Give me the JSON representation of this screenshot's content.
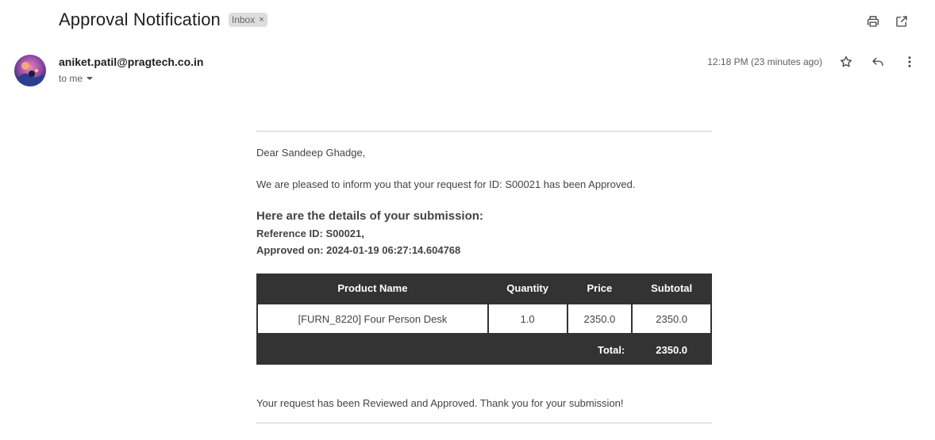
{
  "header": {
    "subject": "Approval Notification",
    "label": "Inbox",
    "label_remove_glyph": "×",
    "actions": [
      "print-icon",
      "open-in-new-window-icon"
    ]
  },
  "message": {
    "sender": "aniket.patil@pragtech.co.in",
    "recipient": "to me",
    "timestamp": "12:18 PM (23 minutes ago)",
    "actions": [
      "star-icon",
      "reply-icon",
      "more-vert-icon"
    ]
  },
  "body": {
    "greeting": "Dear Sandeep Ghadge,",
    "intro": "We are pleased to inform you that your request for ID: S00021 has been Approved.",
    "details_heading": "Here are the details of your submission:",
    "reference_label": "Reference ID:",
    "reference_value": "S00021,",
    "approved_label": "Approved on:",
    "approved_value": "2024-01-19 06:27:14.604768",
    "table": {
      "headers": [
        "Product Name",
        "Quantity",
        "Price",
        "Subtotal"
      ],
      "rows": [
        [
          "[FURN_8220] Four Person Desk",
          "1.0",
          "2350.0",
          "2350.0"
        ]
      ],
      "total_label": "Total:",
      "total_value": "2350.0"
    },
    "closing": "Your request has been Reviewed and Approved. Thank you for your submission!"
  },
  "colors": {
    "table_header_bg": "#333333",
    "label_chip_bg": "#dddddd",
    "body_text": "#444444"
  }
}
